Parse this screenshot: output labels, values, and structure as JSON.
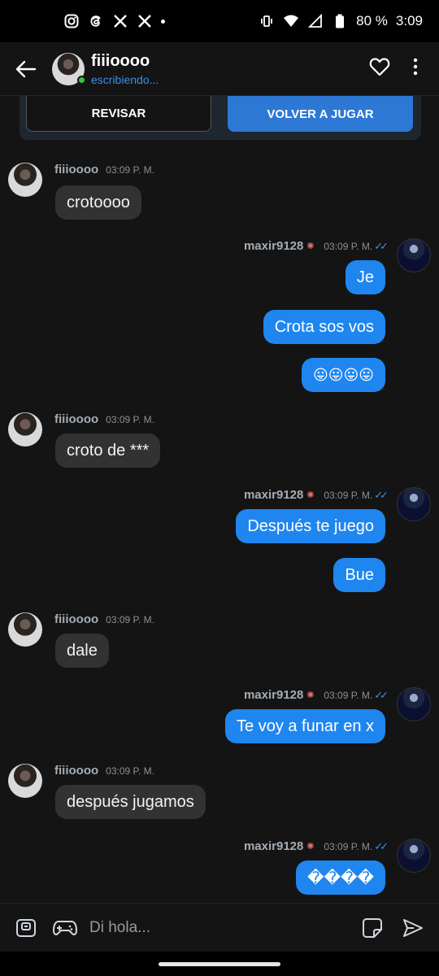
{
  "status_bar": {
    "time": "3:09",
    "battery": "80 %"
  },
  "header": {
    "name": "fiiioooo",
    "subtitle": "escribiendo..."
  },
  "game_card": {
    "review_label": "REVISAR",
    "replay_label": "VOLVER A JUGAR"
  },
  "messages": [
    {
      "sender": "fiiioooo",
      "time": "03:09 P. M.",
      "texts": [
        "crotoooo"
      ]
    },
    {
      "sender": "maxir9128",
      "time": "03:09 P. M.",
      "texts": [
        "Je",
        "Crota sos vos",
        "😛😛😛😛"
      ]
    },
    {
      "sender": "fiiioooo",
      "time": "03:09 P. M.",
      "texts": [
        "croto de ***"
      ]
    },
    {
      "sender": "maxir9128",
      "time": "03:09 P. M.",
      "texts": [
        "Después te juego",
        "Bue"
      ]
    },
    {
      "sender": "fiiioooo",
      "time": "03:09 P. M.",
      "texts": [
        "dale"
      ]
    },
    {
      "sender": "maxir9128",
      "time": "03:09 P. M.",
      "texts": [
        "Te voy a funar en x"
      ]
    },
    {
      "sender": "fiiioooo",
      "time": "03:09 P. M.",
      "texts": [
        "después jugamos"
      ]
    },
    {
      "sender": "maxir9128",
      "time": "03:09 P. M.",
      "texts": [
        "����"
      ]
    }
  ],
  "composer": {
    "placeholder": "Di hola..."
  },
  "colors": {
    "outgoing_bubble": "#1f86f0",
    "incoming_bubble": "#323232",
    "accent": "#3d8fe0"
  }
}
